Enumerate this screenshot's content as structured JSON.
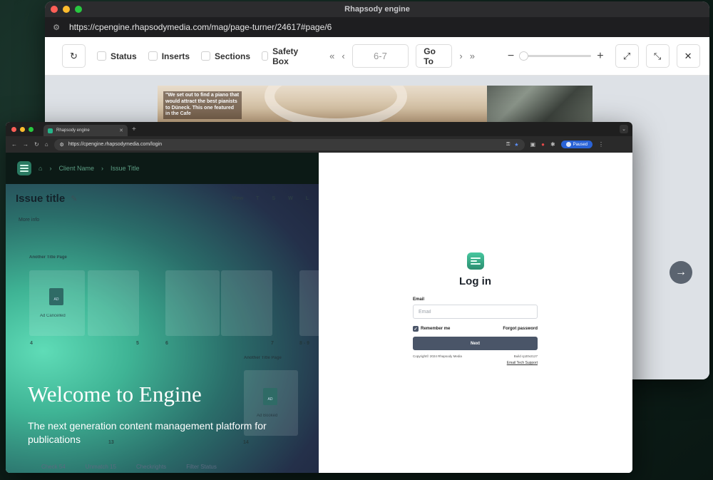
{
  "back_window": {
    "title": "Rhapsody engine",
    "url": "https://cpengine.rhapsodymedia.com/mag/page-turner/24617#page/6",
    "toolbar": {
      "filters": [
        "Status",
        "Inserts",
        "Sections",
        "Safety Box"
      ],
      "first_symbol": "«",
      "prev_symbol": "‹",
      "page_value": "6-7",
      "goto_label": "Go To",
      "next_symbol": "›",
      "last_symbol": "»",
      "zoom_out_symbol": "−",
      "zoom_in_symbol": "+",
      "zoom_level": 0.03
    },
    "magazine_quote": "\"We set out to find a piano that would attract the best pianists to Düneck. This one featured in the Cafe"
  },
  "front_window": {
    "tab_title": "Rhapsody engine",
    "url": "https://cpengine.rhapsodymedia.com/login",
    "profile_status": "Paused",
    "dashboard": {
      "breadcrumb": [
        "Client Name",
        "Issue Title"
      ],
      "issue_title": "Issue title",
      "view_label": "View",
      "view_letters": [
        "T",
        "S",
        "W",
        "L"
      ],
      "more_info": "More info",
      "page_title_a": "Another Title Page",
      "page_title_b": "Another Title Page",
      "card_status_a": "Ad Cancelled",
      "card_status_b": "Ad Booked",
      "page_numbers": [
        "4",
        "5",
        "6",
        "7",
        "8 - 9",
        "13",
        "14"
      ],
      "welcome": "Welcome to Engine",
      "tagline": "The next generation content management platform for publications",
      "bottom_items": [
        "Check 54",
        "Unmatch 15",
        "Checkrights",
        "Filter Status"
      ]
    },
    "login": {
      "title": "Log in",
      "email_label": "Email",
      "email_placeholder": "Email",
      "remember_label": "Remember me",
      "forgot_label": "Forgot password",
      "next_label": "Next",
      "copyright": "Copyright© 2024 Rhapsody Media",
      "build": "Build cp20v2127",
      "support": "Email Tech Support"
    }
  }
}
